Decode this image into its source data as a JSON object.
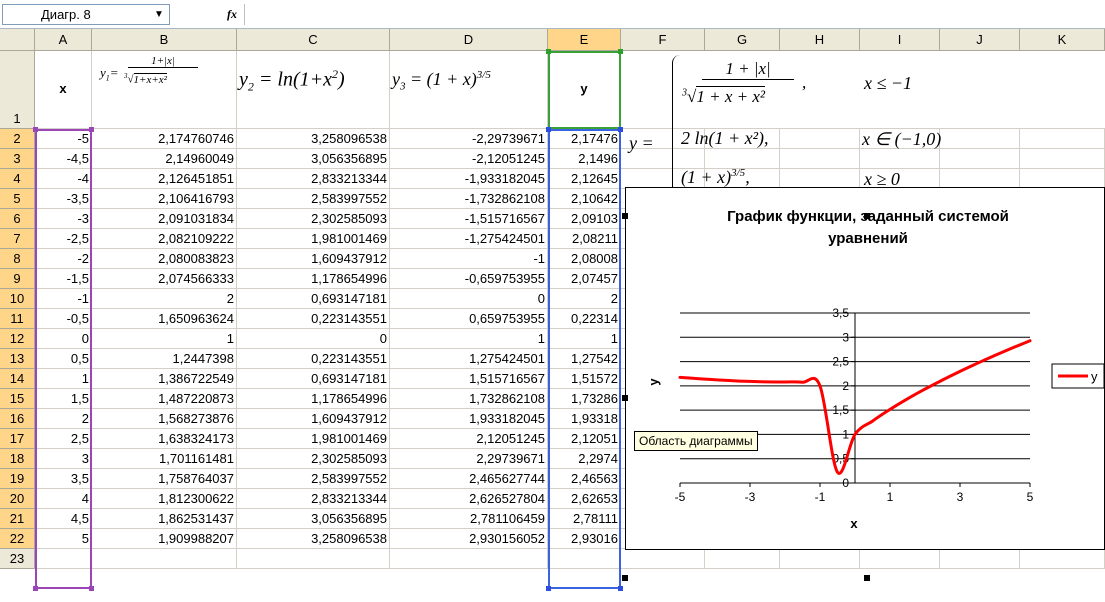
{
  "namebox": {
    "value": "Диагр. 8"
  },
  "formula_bar": {
    "fx_label": "fx",
    "value": ""
  },
  "columns": [
    "A",
    "B",
    "C",
    "D",
    "E",
    "F",
    "G",
    "H",
    "I",
    "J",
    "K"
  ],
  "rows": [
    "1",
    "2",
    "3",
    "4",
    "5",
    "6",
    "7",
    "8",
    "9",
    "10",
    "11",
    "12",
    "13",
    "14",
    "15",
    "16",
    "17",
    "18",
    "19",
    "20",
    "21",
    "22",
    "23"
  ],
  "header_row": {
    "A": "x",
    "B": {
      "lhs": "y",
      "sub": "1",
      "num": "1+|x|",
      "den_root": "3",
      "den": "1+x+x²"
    },
    "C": {
      "lhs": "y",
      "sub": "2",
      "eq": " = ln(1+x",
      "sup": "2",
      "tail": ")"
    },
    "D": {
      "lhs": "y",
      "sub": "3",
      "eq": " = (1 + x)",
      "sup": "3/5"
    },
    "E": "y"
  },
  "system": {
    "lhs": "y =",
    "c1_num": "1 + |x|",
    "c1_den_root": "3",
    "c1_den": "1 + x + x²",
    "c1_tail": ",",
    "c1_cond": "x ≤ −1",
    "c2_expr": "2 ln(1 + x²),",
    "c2_cond": "x ∈ (−1,0)",
    "c3_expr": "(1 + x)",
    "c3_sup": "3/5",
    "c3_tail": ",",
    "c3_cond": "x ≥ 0"
  },
  "table": [
    [
      "-5",
      "2,174760746",
      "3,258096538",
      "-2,29739671",
      "2,17476"
    ],
    [
      "-4,5",
      "2,14960049",
      "3,056356895",
      "-2,12051245",
      "2,1496"
    ],
    [
      "-4",
      "2,126451851",
      "2,833213344",
      "-1,933182045",
      "2,12645"
    ],
    [
      "-3,5",
      "2,106416793",
      "2,583997552",
      "-1,732862108",
      "2,10642"
    ],
    [
      "-3",
      "2,091031834",
      "2,302585093",
      "-1,515716567",
      "2,09103"
    ],
    [
      "-2,5",
      "2,082109222",
      "1,981001469",
      "-1,275424501",
      "2,08211"
    ],
    [
      "-2",
      "2,080083823",
      "1,609437912",
      "-1",
      "2,08008"
    ],
    [
      "-1,5",
      "2,074566333",
      "1,178654996",
      "-0,659753955",
      "2,07457"
    ],
    [
      "-1",
      "2",
      "0,693147181",
      "0",
      "2"
    ],
    [
      "-0,5",
      "1,650963624",
      "0,223143551",
      "0,659753955",
      "0,22314"
    ],
    [
      "0",
      "1",
      "0",
      "1",
      "1"
    ],
    [
      "0,5",
      "1,2447398",
      "0,223143551",
      "1,275424501",
      "1,27542"
    ],
    [
      "1",
      "1,386722549",
      "0,693147181",
      "1,515716567",
      "1,51572"
    ],
    [
      "1,5",
      "1,487220873",
      "1,178654996",
      "1,732862108",
      "1,73286"
    ],
    [
      "2",
      "1,568273876",
      "1,609437912",
      "1,933182045",
      "1,93318"
    ],
    [
      "2,5",
      "1,638324173",
      "1,981001469",
      "2,12051245",
      "2,12051"
    ],
    [
      "3",
      "1,701161481",
      "2,302585093",
      "2,29739671",
      "2,2974"
    ],
    [
      "3,5",
      "1,758764037",
      "2,583997552",
      "2,465627744",
      "2,46563"
    ],
    [
      "4",
      "1,812300622",
      "2,833213344",
      "2,626527804",
      "2,62653"
    ],
    [
      "4,5",
      "1,862531437",
      "3,056356895",
      "2,781106459",
      "2,78111"
    ],
    [
      "5",
      "1,909988207",
      "3,258096538",
      "2,930156052",
      "2,93016"
    ]
  ],
  "tooltip": "Область диаграммы",
  "colors": {
    "series": "#ff0000",
    "selection_a": "#9a46b9",
    "selection_e": "#3a63e0",
    "header_bg": "#ece9d8"
  },
  "chart_data": {
    "type": "line",
    "title": "График функции, заданный системой уравнений",
    "xlabel": "x",
    "ylabel": "y",
    "xlim": [
      -5,
      5
    ],
    "ylim": [
      0,
      3.5
    ],
    "x_ticks": [
      "-5",
      "-3",
      "-1",
      "1",
      "3",
      "5"
    ],
    "y_ticks": [
      "0",
      "0,5",
      "1",
      "1,5",
      "2",
      "2,5",
      "3",
      "3,5"
    ],
    "grid": "horizontal",
    "legend": "right",
    "series": [
      {
        "name": "y",
        "x": [
          -5,
          -4.5,
          -4,
          -3.5,
          -3,
          -2.5,
          -2,
          -1.5,
          -1,
          -0.5,
          0,
          0.5,
          1,
          1.5,
          2,
          2.5,
          3,
          3.5,
          4,
          4.5,
          5
        ],
        "y": [
          2.17476,
          2.1496,
          2.12645,
          2.10642,
          2.09103,
          2.08211,
          2.08008,
          2.07457,
          2,
          0.22314,
          1,
          1.27542,
          1.51572,
          1.73286,
          1.93318,
          2.12051,
          2.2974,
          2.46563,
          2.62653,
          2.78111,
          2.93016
        ]
      }
    ]
  }
}
